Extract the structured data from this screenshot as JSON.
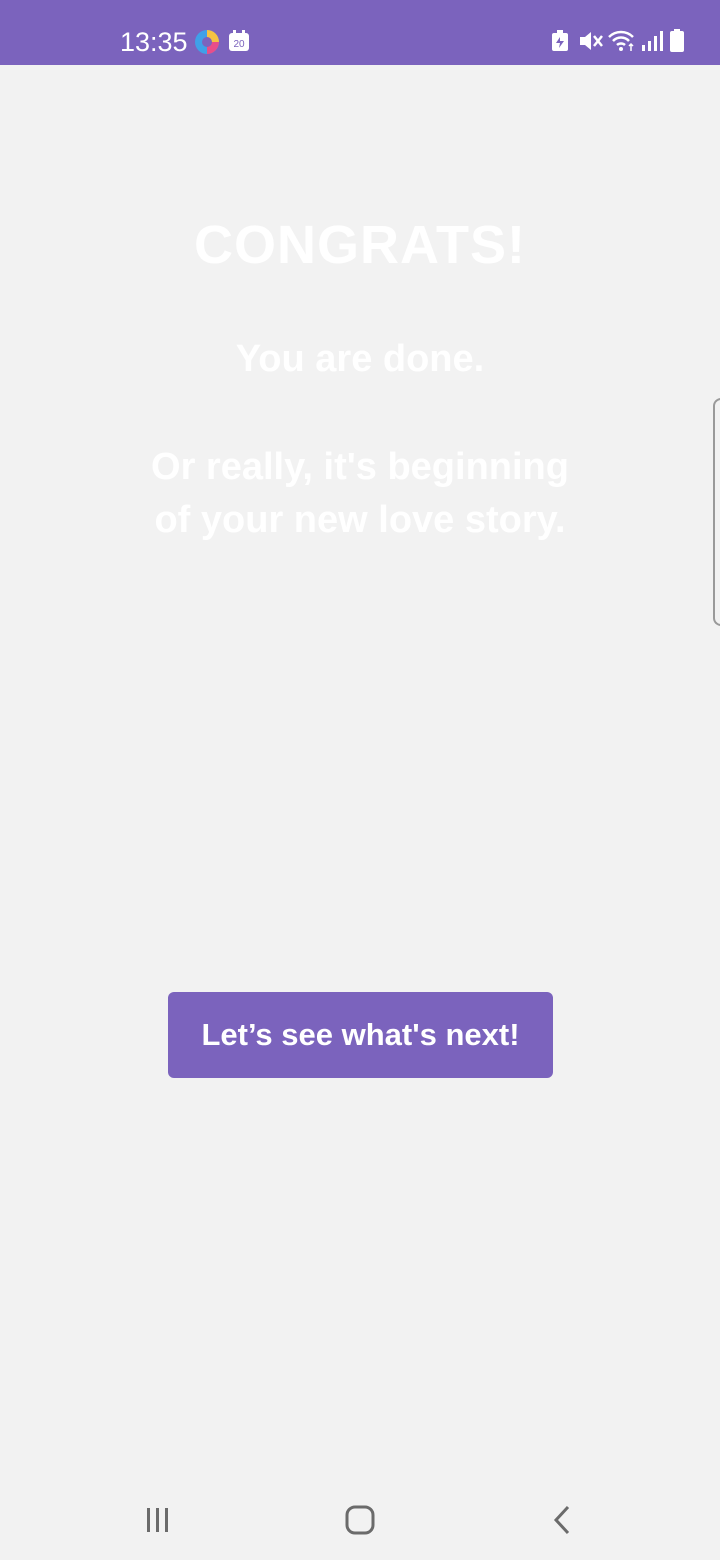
{
  "status_bar": {
    "time": "13:35",
    "calendar_day": "20",
    "background": "#7b63bd"
  },
  "main": {
    "title": "CONGRATS!",
    "subtitle": "You are done.",
    "message_line1": "Or really, it's beginning",
    "message_line2": "of your new love story.",
    "next_button_label": "Let’s see what's next!",
    "accent_color": "#7b63bd"
  },
  "nav_bar": {
    "recent_apps": "recent-apps-icon",
    "home": "home-icon",
    "back": "back-icon"
  }
}
